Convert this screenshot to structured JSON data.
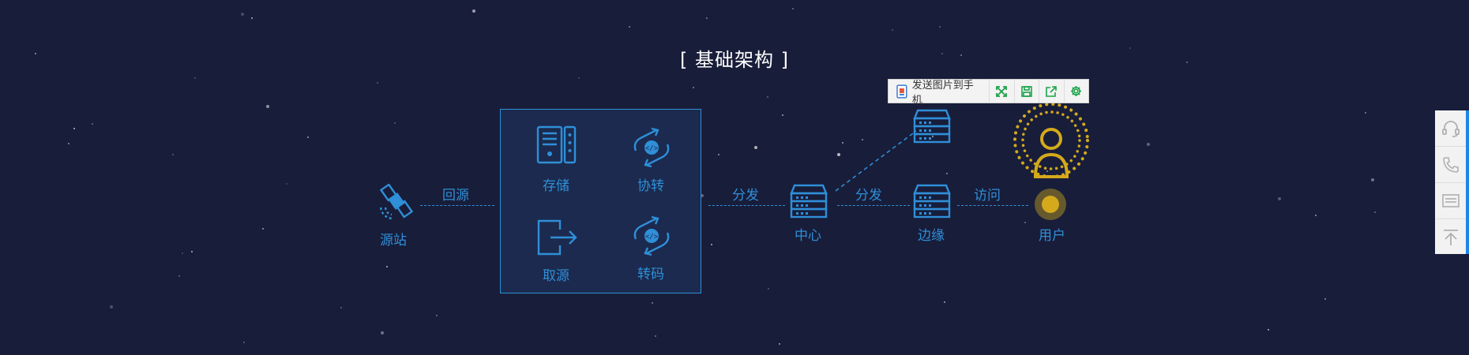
{
  "title": "[ 基础架构 ]",
  "nodes": {
    "source": "源站",
    "storage": "存储",
    "transfer": "协转",
    "fetch": "取源",
    "transcode": "转码",
    "center": "中心",
    "edge": "边缘",
    "user": "用户"
  },
  "edges": {
    "back_to_source": "回源",
    "distribute_1": "分发",
    "distribute_2": "分发",
    "access": "访问"
  },
  "toolbar": {
    "send_label": "发送图片到手机",
    "buttons": [
      "fullscreen-icon",
      "save-icon",
      "share-icon",
      "gear-icon"
    ]
  },
  "rail": {
    "items": [
      "headset-icon",
      "phone-icon",
      "message-icon",
      "back-to-top-icon"
    ]
  },
  "colors": {
    "background": "#181d3a",
    "accent": "#2f8fd8",
    "user_gold": "#d4a91b",
    "box_fill": "#1b2a4e",
    "rail_accent": "#1f86e6"
  }
}
